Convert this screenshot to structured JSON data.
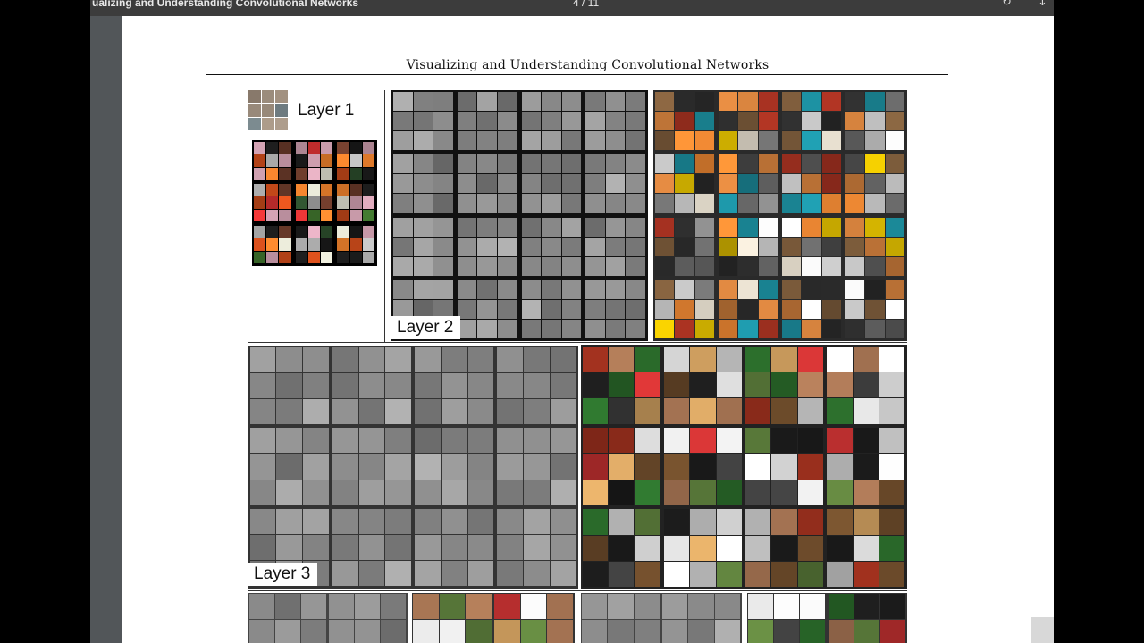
{
  "viewer": {
    "doc_title": "ualizing and Understanding Convolutional Networks",
    "page_indicator": "4 / 11",
    "rotate_icon": "rotate-icon",
    "download_icon": "download-icon"
  },
  "page": {
    "running_title": "Visualizing and Understanding Convolutional Networks",
    "layer_labels": [
      "Layer 1",
      "Layer 2",
      "Layer 3"
    ]
  }
}
